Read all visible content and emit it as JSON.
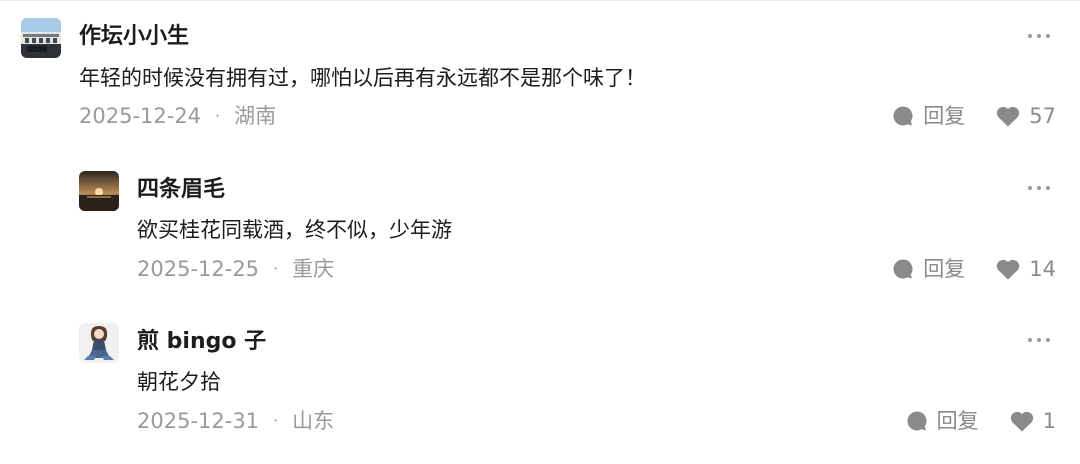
{
  "comments": [
    {
      "username": "作坛小小生",
      "text": "年轻的时候没有拥有过，哪怕以后再有永远都不是那个味了！",
      "date": "2025-12-24",
      "location": "湖南",
      "reply_label": "回复",
      "likes": "57",
      "avatar_icon": "building-photo-avatar"
    },
    {
      "username": "四条眉毛",
      "text": "欲买桂花同载酒，终不似，少年游",
      "date": "2025-12-25",
      "location": "重庆",
      "reply_label": "回复",
      "likes": "14",
      "avatar_icon": "sunset-photo-avatar"
    },
    {
      "username": "煎 bingo 子",
      "text": "朝花夕拾",
      "date": "2025-12-31",
      "location": "山东",
      "reply_label": "回复",
      "likes": "1",
      "avatar_icon": "anime-girl-avatar"
    }
  ],
  "separator": "·",
  "colors": {
    "text": "#1c1c1c",
    "muted": "#9a9a9a",
    "icon": "#8a8a8a"
  }
}
